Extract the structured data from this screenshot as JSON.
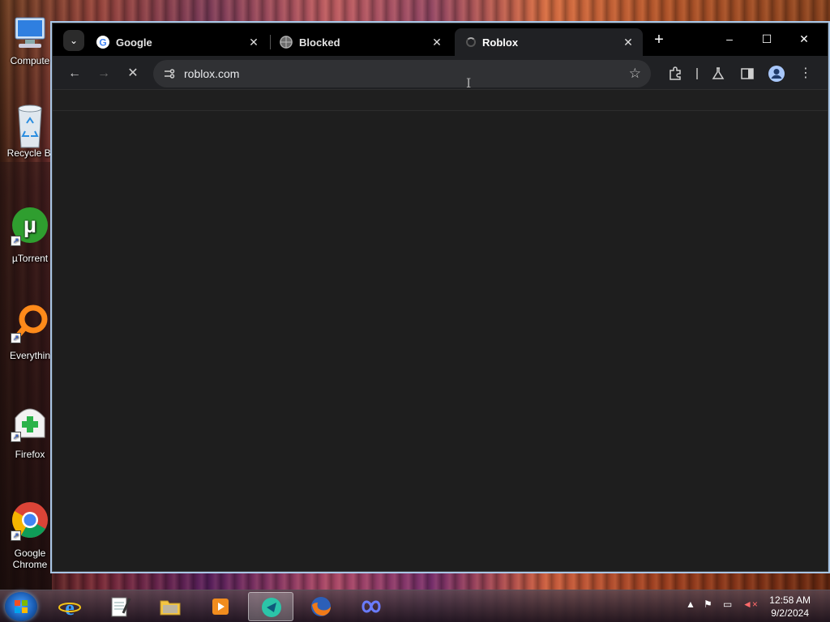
{
  "desktop": {
    "icons": [
      {
        "label": "Compute"
      },
      {
        "label": "Recycle Bi"
      },
      {
        "label": "µTorrent"
      },
      {
        "label": "Everythin"
      },
      {
        "label": "Firefox"
      },
      {
        "label": "Google Chrome"
      }
    ]
  },
  "browser": {
    "tabs": [
      {
        "title": "Google",
        "favicon": "google-icon",
        "active": false
      },
      {
        "title": "Blocked",
        "favicon": "globe-icon",
        "active": false
      },
      {
        "title": "Roblox",
        "favicon": "loading-icon",
        "active": true
      }
    ],
    "tab_close": "✕",
    "new_tab": "+",
    "url": "roblox.com",
    "window_controls": {
      "minimize": "–",
      "maximize": "☐",
      "close": "✕"
    }
  },
  "taskbar": {
    "apps": [
      "internet-explorer-icon",
      "notepad-icon",
      "file-explorer-icon",
      "media-player-icon",
      "active-app-icon",
      "firefox-icon",
      "app-icon"
    ],
    "clock": {
      "time": "12:58 AM",
      "date": "9/2/2024"
    }
  }
}
